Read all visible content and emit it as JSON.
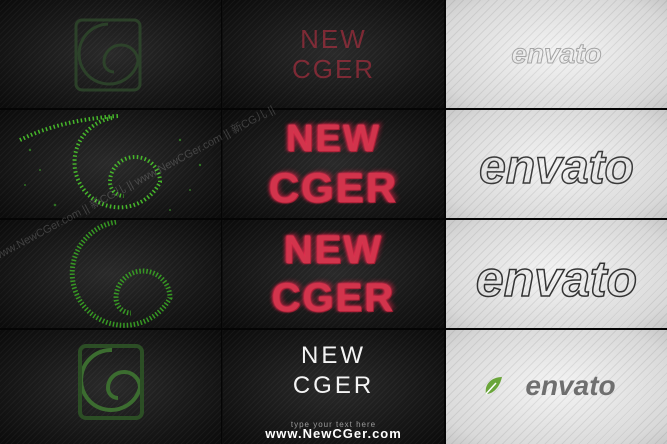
{
  "panels": {
    "logo_text_line1": "NEW",
    "logo_text_line2": "CGER",
    "tagline": "type your text here",
    "brand": "envato",
    "brand_tm": "™"
  },
  "watermark": {
    "text": "www.NewCGer.com || 新CG儿 || www.NewCGer.com || 新CG儿 ||"
  },
  "footer": {
    "text": "www.NewCGer.com"
  },
  "colors": {
    "particle_red": "#d2344c",
    "particle_green": "#3fae2a",
    "envato_green": "#6aa53a"
  }
}
